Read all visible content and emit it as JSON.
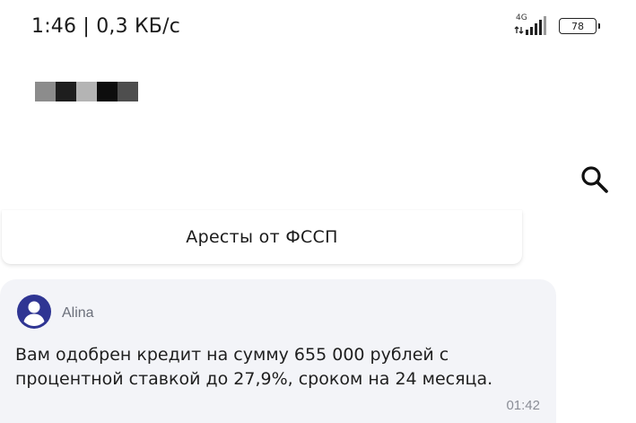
{
  "status_bar": {
    "time": "1:46 | 0,3 КБ/с",
    "network": "4G",
    "battery": "78"
  },
  "header": {
    "redacted_colors": [
      "#8c8c8c",
      "#1e1e1e",
      "#b4b4b4",
      "#0d0d0d",
      "#4e4e4e"
    ]
  },
  "icons": {
    "search": "search-icon",
    "avatar": "user-avatar-icon"
  },
  "quick_reply": {
    "label": "Аресты от ФССП"
  },
  "message": {
    "sender": "Alina",
    "text": "Вам одобрен кредит на сумму 655 000 рублей с процентной ставкой до 27,9%, сроком на 24 месяца.",
    "time": "01:42"
  },
  "colors": {
    "accent": "#2f3593",
    "bubble": "#f3f4f8"
  }
}
